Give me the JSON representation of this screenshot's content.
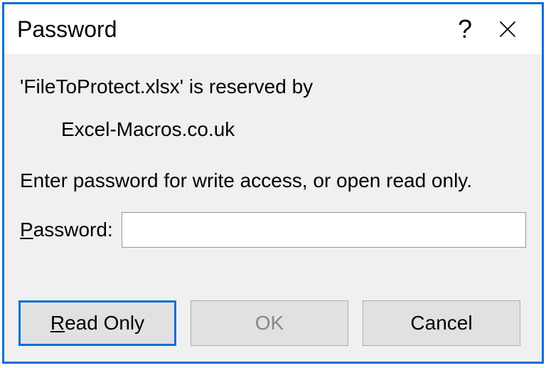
{
  "titlebar": {
    "title": "Password",
    "help_symbol": "?",
    "close_label": "Close"
  },
  "content": {
    "reserved_prefix": "'",
    "reserved_filename": "FileToProtect.xlsx",
    "reserved_suffix": "' is reserved by",
    "reserved_by": "Excel-Macros.co.uk",
    "instruction": "Enter password for write access, or open read only.",
    "password_label_underline": "P",
    "password_label_rest": "assword:",
    "password_value": ""
  },
  "buttons": {
    "readonly_underline": "R",
    "readonly_rest": "ead Only",
    "ok_label": "OK",
    "cancel_label": "Cancel"
  }
}
